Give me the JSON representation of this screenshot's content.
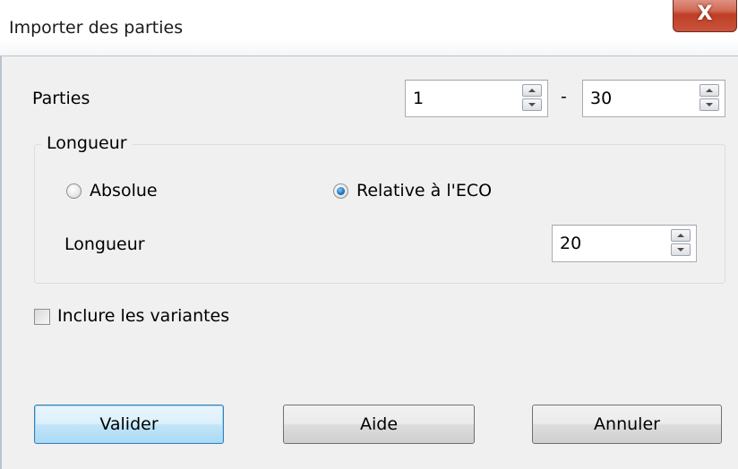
{
  "window": {
    "title": "Importer des parties",
    "close_glyph": "X"
  },
  "games": {
    "label": "Parties",
    "from_value": "1",
    "separator": "-",
    "to_value": "30"
  },
  "length_group": {
    "legend": "Longueur",
    "option_absolute": {
      "label": "Absolue",
      "checked": false
    },
    "option_relative": {
      "label": "Relative à l'ECO",
      "checked": true
    },
    "length_label": "Longueur",
    "length_value": "20"
  },
  "include_variants": {
    "label": "Inclure les variantes",
    "checked": false
  },
  "buttons": {
    "ok_label": "Valider",
    "help_label": "Aide",
    "cancel_label": "Annuler"
  },
  "icons": {
    "close": "close-icon",
    "spin_up": "spin-up-arrow-icon",
    "spin_down": "spin-down-arrow-icon"
  }
}
